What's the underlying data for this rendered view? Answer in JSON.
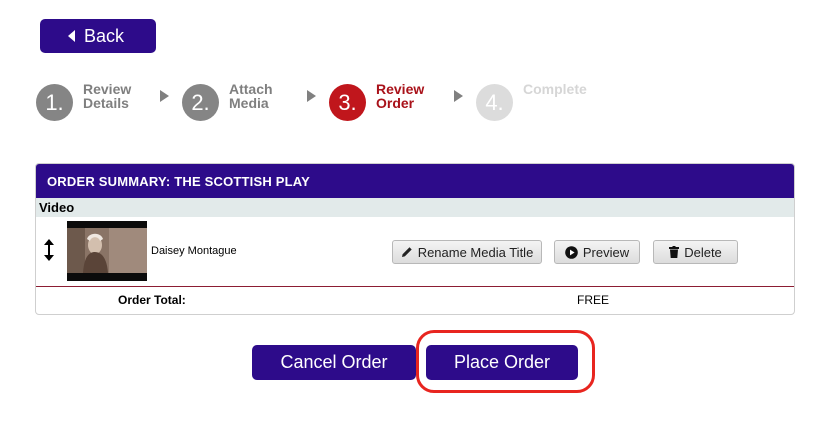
{
  "back": {
    "label": "Back"
  },
  "steps": [
    {
      "number": "1.",
      "line1": "Review",
      "line2": "Details",
      "state": "done"
    },
    {
      "number": "2.",
      "line1": "Attach",
      "line2": "Media",
      "state": "done"
    },
    {
      "number": "3.",
      "line1": "Review",
      "line2": "Order",
      "state": "active"
    },
    {
      "number": "4.",
      "line1": "Complete",
      "line2": "",
      "state": "todo"
    }
  ],
  "summary": {
    "title": "ORDER SUMMARY: THE SCOTTISH PLAY",
    "section": "Video",
    "media_title": "Daisey Montague",
    "buttons": {
      "rename": "Rename Media Title",
      "preview": "Preview",
      "delete": "Delete"
    },
    "total_label": "Order Total:",
    "total_value": "FREE"
  },
  "actions": {
    "cancel": "Cancel Order",
    "place": "Place Order"
  },
  "colors": {
    "brand": "#2d0b8a",
    "active_step": "#c0161c",
    "highlight": "#e8251f"
  }
}
